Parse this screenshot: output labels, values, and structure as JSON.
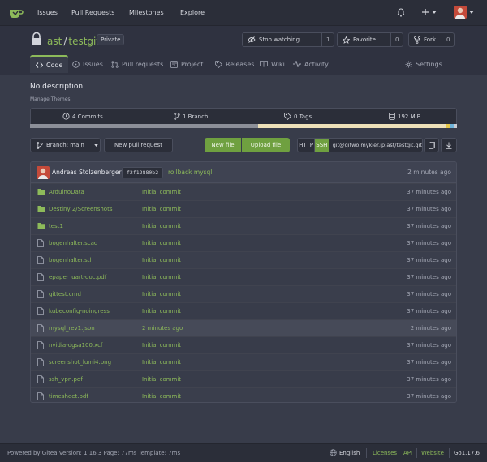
{
  "nav": {
    "links": [
      "Issues",
      "Pull Requests",
      "Milestones",
      "Explore"
    ]
  },
  "repo": {
    "owner": "ast",
    "name": "testgit",
    "visibility": "Private",
    "watch_label": "Stop watching",
    "watch_count": "1",
    "favorite_label": "Favorite",
    "favorite_count": "0",
    "fork_label": "Fork",
    "fork_count": "0"
  },
  "tabs": [
    "Code",
    "Issues",
    "Pull requests",
    "Project",
    "Releases",
    "Wiki",
    "Activity",
    "Settings"
  ],
  "description": "No description",
  "manage_themes": "Manage Themes",
  "stats": {
    "commits": "4 Commits",
    "branches": "1 Branch",
    "tags": "0 Tags",
    "size": "192 MiB"
  },
  "toolbar": {
    "branch_label": "Branch: main",
    "new_pr": "New pull request",
    "new_file": "New file",
    "upload_file": "Upload file",
    "http": "HTTP",
    "ssh": "SSH",
    "clone_url": "git@gitwo.mykier.ip:ast/testgit.git"
  },
  "last_commit": {
    "author": "Andreas Stolzenberger",
    "sha": "f2f12880b2",
    "message": "rollback mysql",
    "time": "2 minutes ago"
  },
  "files": [
    {
      "name": "ArduinoData",
      "type": "folder",
      "message": "Initial commit",
      "time": "37 minutes ago"
    },
    {
      "name": "Destiny 2/Screenshots",
      "type": "folder",
      "message": "Initial commit",
      "time": "37 minutes ago"
    },
    {
      "name": "test1",
      "type": "folder",
      "message": "Initial commit",
      "time": "37 minutes ago"
    },
    {
      "name": "bogenhalter.scad",
      "type": "file",
      "message": "Initial commit",
      "time": "37 minutes ago"
    },
    {
      "name": "bogenhalter.stl",
      "type": "file",
      "message": "Initial commit",
      "time": "37 minutes ago"
    },
    {
      "name": "epaper_uart-doc.pdf",
      "type": "file",
      "message": "Initial commit",
      "time": "37 minutes ago"
    },
    {
      "name": "gittest.cmd",
      "type": "file",
      "message": "Initial commit",
      "time": "37 minutes ago"
    },
    {
      "name": "kubeconfig-noingress",
      "type": "file",
      "message": "Initial commit",
      "time": "37 minutes ago"
    },
    {
      "name": "mysql_rev1.json",
      "type": "file",
      "message": "2 minutes ago",
      "time": "2 minutes ago"
    },
    {
      "name": "nvidia-dgsa100.xcf",
      "type": "file",
      "message": "Initial commit",
      "time": "37 minutes ago"
    },
    {
      "name": "screenshot_lumi4.png",
      "type": "file",
      "message": "Initial commit",
      "time": "37 minutes ago"
    },
    {
      "name": "ssh_vpn.pdf",
      "type": "file",
      "message": "Initial commit",
      "time": "37 minutes ago"
    },
    {
      "name": "timesheet.pdf",
      "type": "file",
      "message": "Initial commit",
      "time": "37 minutes ago"
    }
  ],
  "footer": {
    "powered": "Powered by Gitea Version: 1.16.3 Page: 77ms Template: 7ms",
    "language": "English",
    "licenses": "Licenses",
    "api": "API",
    "website": "Website",
    "go_version": "Go1.17.6"
  },
  "colors": {
    "accent": "#8dba5a",
    "background": "#383c4a",
    "button_green": "#6fa040"
  }
}
